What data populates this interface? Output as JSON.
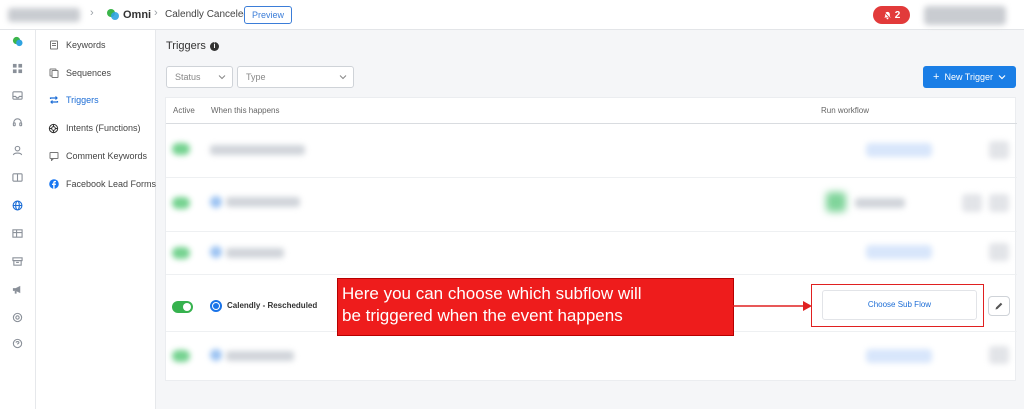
{
  "header": {
    "app_name": "Omni",
    "page_name": "Calendly Canceled",
    "preview_label": "Preview",
    "notification_count": "2"
  },
  "sidebar": {
    "items": [
      {
        "label": "Keywords",
        "icon": "document-icon"
      },
      {
        "label": "Sequences",
        "icon": "copy-icon"
      },
      {
        "label": "Triggers",
        "icon": "repeat-icon",
        "active": true
      },
      {
        "label": "Intents (Functions)",
        "icon": "openai-icon"
      },
      {
        "label": "Comment Keywords",
        "icon": "comment-icon"
      },
      {
        "label": "Facebook Lead Forms",
        "icon": "facebook-icon"
      }
    ]
  },
  "main": {
    "title": "Triggers",
    "filters": {
      "status_placeholder": "Status",
      "type_placeholder": "Type"
    },
    "new_trigger_label": "New Trigger",
    "columns": {
      "active": "Active",
      "when": "When this happens",
      "run": "Run workflow"
    },
    "visible_row": {
      "trigger_label": "Calendly - Rescheduled",
      "action_label": "Choose Sub Flow",
      "active": true
    }
  },
  "annotation": {
    "line1": "Here you can choose which subflow will",
    "line2": "be triggered when the event happens"
  },
  "colors": {
    "accent": "#1a7ee6",
    "alert": "#e23a3a",
    "annotation": "#ee1c1c",
    "toggle_on": "#36b24e"
  }
}
